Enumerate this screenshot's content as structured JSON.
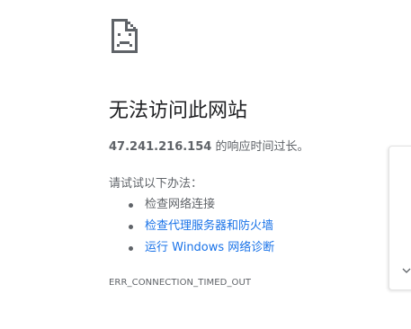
{
  "error": {
    "icon": "sad-page-icon",
    "title": "无法访问此网站",
    "host": "47.241.216.154",
    "message_suffix": " 的响应时间过长。",
    "suggestions_heading": "请试试以下办法：",
    "suggestions": [
      {
        "label": "检查网络连接",
        "is_link": false
      },
      {
        "label": "检查代理服务器和防火墙",
        "is_link": true
      },
      {
        "label": "运行 Windows 网络诊断",
        "is_link": true
      }
    ],
    "code": "ERR_CONNECTION_TIMED_OUT"
  },
  "side_panel": {
    "icon": "chevron-down-icon"
  },
  "colors": {
    "text": "#202124",
    "secondary_text": "#5f6368",
    "link": "#1a73e8",
    "icon_gray": "#5f6368"
  }
}
